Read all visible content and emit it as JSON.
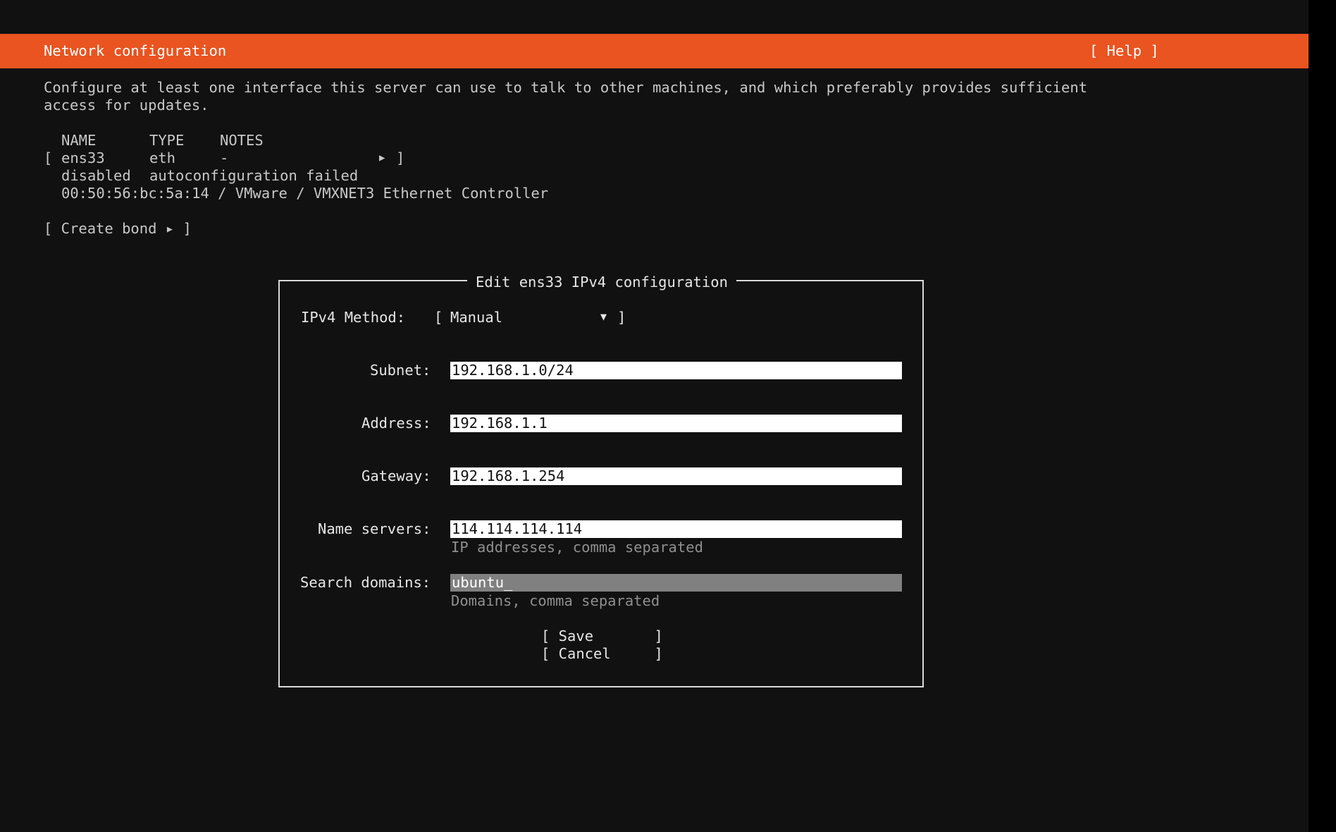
{
  "header": {
    "title": "Network configuration",
    "help_label": "[ Help ]",
    "bg_color": "#e95420"
  },
  "description": {
    "line1": "Configure at least one interface this server can use to talk to other machines, and which preferably provides sufficient",
    "line2": "access for updates."
  },
  "interfaces": {
    "headers": {
      "name": "NAME",
      "type": "TYPE",
      "notes": "NOTES"
    },
    "rows": [
      {
        "open_bracket": "[",
        "name": "ens33",
        "type": "eth",
        "notes": "-",
        "expand_icon": "triangle-right-icon",
        "close_bracket": "]",
        "status": "disabled",
        "status_detail": "autoconfiguration failed",
        "hardware": "00:50:56:bc:5a:14 / VMware / VMXNET3 Ethernet Controller"
      }
    ]
  },
  "create_bond": {
    "label": "[ Create bond ▸ ]"
  },
  "dialog": {
    "title": "Edit ens33 IPv4 configuration",
    "method_label": "IPv4 Method:",
    "method_open": "[",
    "method_value": "Manual",
    "method_arrow": "▼",
    "method_close": "]",
    "subnet": {
      "label": "Subnet:",
      "value": "192.168.1.0/24"
    },
    "address": {
      "label": "Address:",
      "value": "192.168.1.1"
    },
    "gateway": {
      "label": "Gateway:",
      "value": "192.168.1.254"
    },
    "name_servers": {
      "label": "Name servers:",
      "value": "114.114.114.114",
      "hint": "IP addresses, comma separated"
    },
    "search_domains": {
      "label": "Search domains:",
      "value": "ubuntu_",
      "hint": "Domains, comma separated"
    },
    "save_label": "[ Save       ]",
    "cancel_label": "[ Cancel     ]"
  }
}
